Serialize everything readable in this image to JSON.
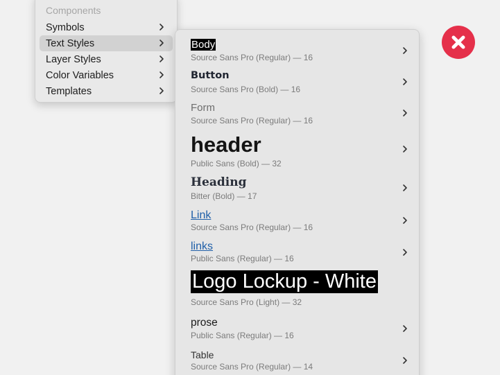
{
  "left_menu": {
    "header": "Components",
    "items": [
      {
        "label": "Symbols",
        "icon": "chevron-right-icon"
      },
      {
        "label": "Text Styles",
        "icon": "chevron-right-icon",
        "active": true
      },
      {
        "label": "Layer Styles",
        "icon": "chevron-right-icon"
      },
      {
        "label": "Color Variables",
        "icon": "chevron-right-icon"
      },
      {
        "label": "Templates",
        "icon": "chevron-right-icon"
      }
    ]
  },
  "text_styles": [
    {
      "name": "Body",
      "meta": "Source Sans Pro (Regular) — 16"
    },
    {
      "name": "Button",
      "meta": "Source Sans Pro (Bold) — 16"
    },
    {
      "name": "Form",
      "meta": "Source Sans Pro (Regular) — 16"
    },
    {
      "name": "header",
      "meta": "Public Sans (Bold) — 32"
    },
    {
      "name": "Heading",
      "meta": "Bitter (Bold) — 17"
    },
    {
      "name": "Link",
      "meta": "Source Sans Pro (Regular) — 16"
    },
    {
      "name": "links",
      "meta": "Public Sans (Regular) — 16"
    },
    {
      "name": "Logo Lockup - White",
      "meta": "Source Sans Pro (Light) — 32"
    },
    {
      "name": "prose",
      "meta": "Public Sans (Regular) — 16"
    },
    {
      "name": "Table",
      "meta": "Source Sans Pro (Regular) — 14"
    }
  ],
  "colors": {
    "close_badge": "#e5304a",
    "link": "#1f5fa8",
    "menu_bg": "#e6e6e6",
    "active_item": "#d2d2d2"
  },
  "icons": {
    "close": "close-icon",
    "chevron": "chevron-right-icon"
  }
}
